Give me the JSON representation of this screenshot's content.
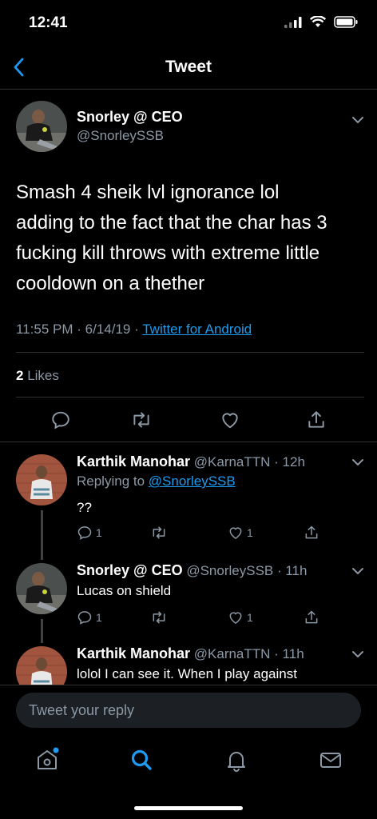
{
  "status": {
    "time": "12:41"
  },
  "nav": {
    "title": "Tweet"
  },
  "tweet": {
    "display_name": "Snorley @ CEO",
    "handle": "@SnorleySSB",
    "text": "Smash 4 sheik lvl ignorance lol adding to the fact that the char has 3 fucking kill throws with extreme little cooldown on a thether",
    "line1": "Smash 4 sheik lvl ignorance lol",
    "line2": "adding to the fact that the char has 3",
    "line3": "fucking kill throws with extreme little",
    "line4": "cooldown on a thether",
    "time": "11:55 PM",
    "date": "6/14/19",
    "sep": "·",
    "source": "Twitter for Android",
    "likes_count": "2",
    "likes_label": "Likes"
  },
  "replies": [
    {
      "display_name": "Karthik Manohar",
      "handle": "@KarnaTTN",
      "age": "· 12h",
      "replying_prefix": "Replying to",
      "replying_to": "@SnorleySSB",
      "text": "??",
      "reply_count": "1",
      "like_count": "1"
    },
    {
      "display_name": "Snorley @ CEO",
      "handle": "@SnorleySSB",
      "age": "· 11h",
      "text": "Lucas on shield",
      "reply_count": "1",
      "like_count": "1"
    },
    {
      "display_name": "Karthik Manohar",
      "handle": "@KarnaTTN",
      "age": "· 11h",
      "text": "lolol I can see it. When I play against"
    }
  ],
  "composer": {
    "placeholder": "Tweet your reply"
  },
  "tabbar": [
    "home-icon",
    "search-icon",
    "notifications-icon",
    "messages-icon"
  ],
  "colors": {
    "accent": "#1d9bf0",
    "muted": "#8b98a5",
    "background": "#000000"
  }
}
